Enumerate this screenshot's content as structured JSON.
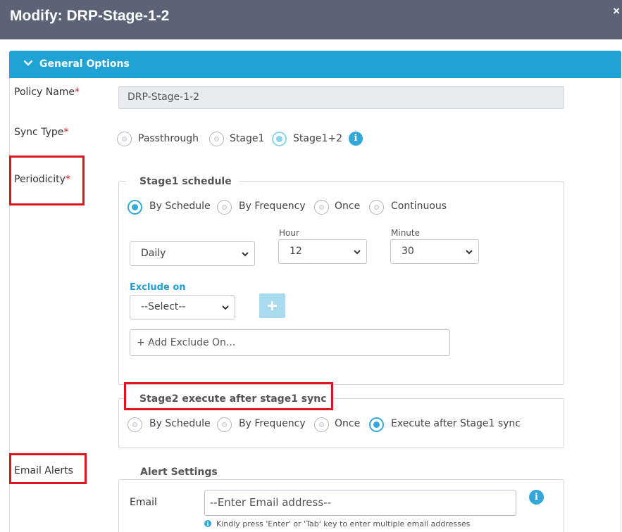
{
  "header": {
    "title": "Modify: DRP-Stage-1-2",
    "close_symbol": "×"
  },
  "section": {
    "title": "General Options",
    "icon": "chevron-down-icon"
  },
  "policy_name": {
    "label": "Policy Name",
    "required_mark": "*",
    "value": "DRP-Stage-1-2"
  },
  "sync_type": {
    "label": "Sync Type",
    "required_mark": "*",
    "options": [
      "Passthrough",
      "Stage1",
      "Stage1+2"
    ],
    "selected": "Stage1+2",
    "info_glyph": "i"
  },
  "periodicity": {
    "label": "Periodicity",
    "required_mark": "*"
  },
  "stage1_schedule": {
    "legend": "Stage1 schedule",
    "options": [
      "By Schedule",
      "By Frequency",
      "Once",
      "Continuous"
    ],
    "selected": "By Schedule",
    "frequency": {
      "value": "Daily"
    },
    "hour": {
      "label": "Hour",
      "value": "12"
    },
    "minute": {
      "label": "Minute",
      "value": "30"
    },
    "exclude_on": {
      "label": "Exclude on",
      "select_value": "--Select--",
      "add_placeholder": "+ Add Exclude On..."
    }
  },
  "stage2": {
    "legend": "Stage2 execute after stage1 sync",
    "options": [
      "By Schedule",
      "By Frequency",
      "Once",
      "Execute after Stage1 sync"
    ],
    "selected": "Execute after Stage1 sync"
  },
  "email_alerts": {
    "label": "Email Alerts",
    "legend": "Alert Settings",
    "email_label": "Email",
    "email_placeholder": "--Enter Email address--",
    "info_glyph": "i",
    "hint": "Kindly press 'Enter' or 'Tab' key to enter multiple email addresses"
  },
  "colors": {
    "header_bg": "#5c6377",
    "accent": "#1fa3d5",
    "required": "#d9221e",
    "highlight_box": "#e0161f"
  }
}
